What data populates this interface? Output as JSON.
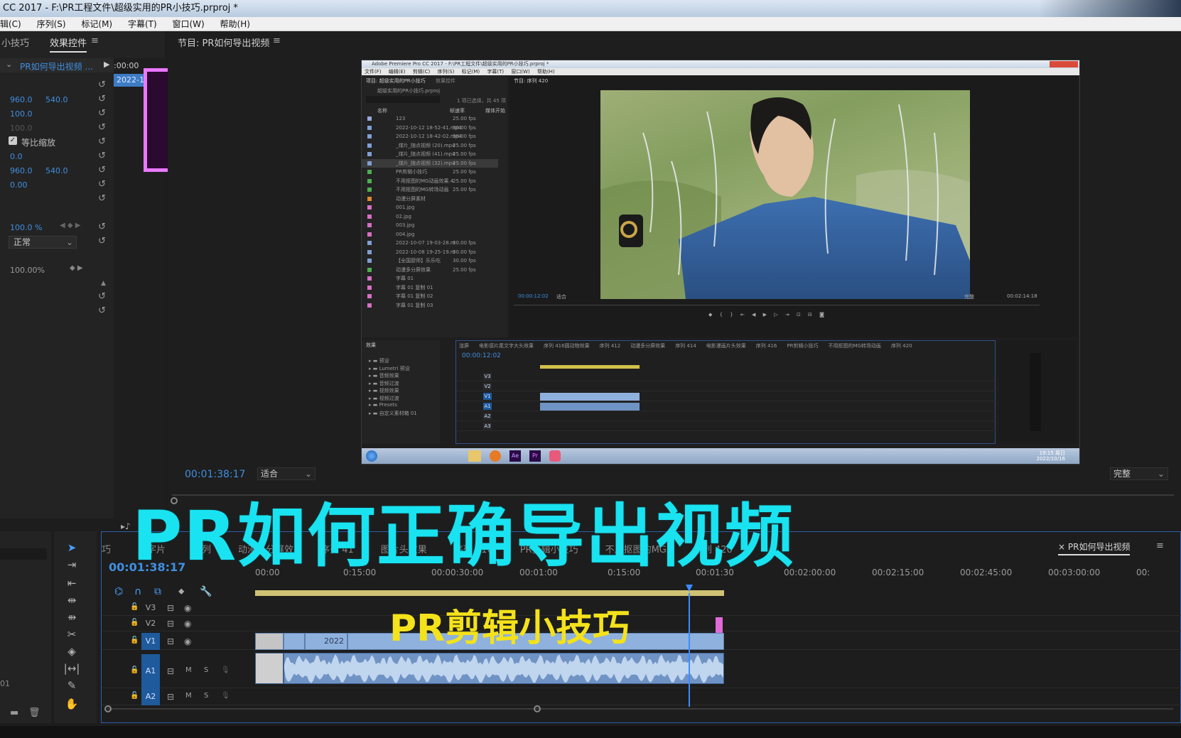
{
  "window": {
    "title": "CC 2017 - F:\\PR工程文件\\超级实用的PR小技巧.prproj *"
  },
  "menu": [
    "辑(C)",
    "序列(S)",
    "标记(M)",
    "字幕(T)",
    "窗口(W)",
    "帮助(H)"
  ],
  "effect_controls": {
    "tab_left": "小技巧",
    "tab_active": "效果控件",
    "menu_icon": "hamburger-icon",
    "clip_name": "PR如何导出视频 ...",
    "timecode": ":00:00",
    "clip_strip": "2022-1(",
    "position_x": "960.0",
    "position_y": "540.0",
    "scale": "100.0",
    "scale_width": "100.0",
    "uniform_scale_label": "等比缩放",
    "rotation": "0.0",
    "anchor_x": "960.0",
    "anchor_y": "540.0",
    "anti_flicker": "0.00",
    "opacity": "100.0 %",
    "blend_mode": "正常",
    "speed": "100.00%"
  },
  "program_monitor": {
    "tab": "节目: PR如何导出视频",
    "timecode": "00:01:38:17",
    "fit": "适合",
    "quality": "完整"
  },
  "inner_screenshot": {
    "title": "Adobe Premiere Pro CC 2017 - F:\\PR工程文件\\超级实用的PR小技巧.prproj *",
    "menu": [
      "文件(F)",
      "编辑(E)",
      "剪辑(C)",
      "序列(S)",
      "标记(M)",
      "字幕(T)",
      "窗口(W)",
      "帮助(H)"
    ],
    "project_tab": "项目: 超级实用的PR小技巧",
    "effects_tab": "效果控件",
    "project_path": "超级实用的PR小技巧.prproj",
    "item_count": "1 项已选择，共 45 项",
    "col_name": "名称",
    "col_fps": "帧速率",
    "col_start": "媒体开始",
    "monitor_tab": "节目: 序列 420",
    "monitor_timecode": "00:00:12:02",
    "monitor_fit": "适合",
    "monitor_quality": "完整",
    "monitor_duration": "00:02:14:18",
    "effects_panel": "效果",
    "effects_tree": [
      "预设",
      "Lumetri 预设",
      "音频效果",
      "音频过渡",
      "视频效果",
      "视频过渡",
      "Presets",
      "自定义素材箱 01"
    ],
    "timeline_timecode": "00:00:12:02",
    "timeline_tabs": [
      "渲屏",
      "电影感片尾文字大头效果",
      "序列 416圆动物效果",
      "序列 412",
      "动漫多分屏效果",
      "序列 414",
      "电影漫画片头效果",
      "序列 416",
      "PR剪辑小技巧",
      "不用抠图的MG转场动画",
      "序列 420"
    ],
    "tracks": [
      "V3",
      "V2",
      "V1",
      "A1",
      "A2",
      "A3"
    ],
    "taskbar_time": "19:15 周日",
    "taskbar_date": "2022/10/16",
    "rows": [
      {
        "name": "123",
        "fps": "25.00 fps",
        "color": "#9aa8d8"
      },
      {
        "name": "2022-10-12 18-52-41.mp4",
        "fps": "30.00 fps",
        "color": "#7f9fd6"
      },
      {
        "name": "2022-10-12 18-42-02.mp4",
        "fps": "30.00 fps",
        "color": "#7f9fd6"
      },
      {
        "name": "_煤片_随点视频 (20).mp4",
        "fps": "25.00 fps",
        "color": "#7f9fd6"
      },
      {
        "name": "_煤片_随点视频 (41).mp4",
        "fps": "25.00 fps",
        "color": "#7f9fd6"
      },
      {
        "name": "_煤片_随点视频 (32).mp4",
        "fps": "25.00 fps",
        "color": "#7f9fd6"
      },
      {
        "name": "PR剪辑小技巧",
        "fps": "25.00 fps",
        "color": "#4caf50"
      },
      {
        "name": "不用抠图的MG动画效果.4",
        "fps": "25.00 fps",
        "color": "#4caf50"
      },
      {
        "name": "不用抠图的MG转场动画",
        "fps": "25.00 fps",
        "color": "#4caf50"
      },
      {
        "name": "动漫分屏素材",
        "fps": "",
        "color": "#e08a2a"
      },
      {
        "name": "001.jpg",
        "fps": "",
        "color": "#d86fc4"
      },
      {
        "name": "02.jpg",
        "fps": "",
        "color": "#d86fc4"
      },
      {
        "name": "003.jpg",
        "fps": "",
        "color": "#d86fc4"
      },
      {
        "name": "004.jpg",
        "fps": "",
        "color": "#d86fc4"
      },
      {
        "name": "2022-10-07 19-03-28.m",
        "fps": "30.00 fps",
        "color": "#7f9fd6"
      },
      {
        "name": "2022-10-08 19-25-19.m",
        "fps": "30.00 fps",
        "color": "#7f9fd6"
      },
      {
        "name": "【全国厨师】乐乐吃",
        "fps": "30.00 fps",
        "color": "#7f9fd6"
      },
      {
        "name": "动漫多分屏效果",
        "fps": "25.00 fps",
        "color": "#4caf50"
      },
      {
        "name": "字幕 01",
        "fps": "",
        "color": "#d86fc4"
      },
      {
        "name": "字幕 01 复制 01",
        "fps": "",
        "color": "#d86fc4"
      },
      {
        "name": "字幕 01 复制 02",
        "fps": "",
        "color": "#d86fc4"
      },
      {
        "name": "字幕 01 复制 03",
        "fps": "",
        "color": "#d86fc4"
      }
    ]
  },
  "timeline": {
    "timecode": "00:01:38:17",
    "tabs": [
      "巧",
      "文字片",
      "序列",
      "动漫多分屏效",
      "序列 41",
      "图片头效果",
      "序列 416",
      "PR剪辑小技巧",
      "不用抠图的MG",
      "序列 420"
    ],
    "active_tab": "PR如何导出视频",
    "ruler": [
      "00:00",
      "0:15:00",
      "00:00:30:00",
      "00:01:00",
      "0:15:00",
      "00:01:30",
      "00:02:00:00",
      "00:02:15:00",
      "00:02:45:00",
      "00:03:00:00",
      "00:"
    ],
    "tracks": [
      "V3",
      "V2",
      "V1",
      "A1",
      "A2"
    ],
    "track_mute": "M",
    "track_solo": "S",
    "clip_text": "2022",
    "left_value": "01"
  },
  "overlay": {
    "title": "PR如何正确导出视频",
    "subtitle": "PR剪辑小技巧",
    "title_color": "#19e3f0",
    "subtitle_color": "#f4e21a"
  },
  "logo": {
    "text": "Pr",
    "color": "#ea77ff"
  }
}
